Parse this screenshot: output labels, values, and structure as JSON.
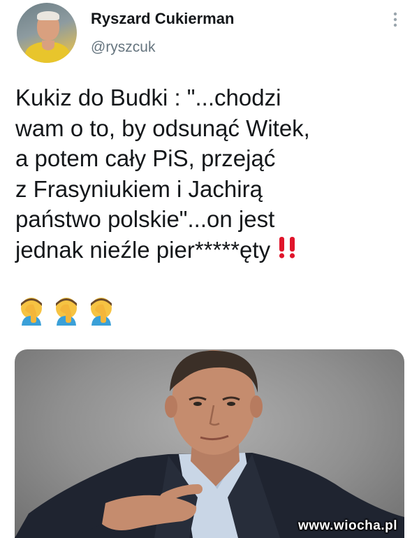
{
  "author": {
    "name": "Ryszard Cukierman",
    "handle": "@ryszcuk"
  },
  "icons": {
    "more": "more-vertical-icon",
    "emphasis": "double-exclamation-icon",
    "emoji": "person-facepalming-icon"
  },
  "tweet": {
    "lines": [
      "Kukiz do Budki : \"...chodzi",
      "wam o to, by odsunąć Witek,",
      "a potem cały PiS, przejąć",
      "z Frasyniukiem i Jachirą",
      "państwo polskie\"...on jest",
      "jednak nieźle pier*****ęty"
    ]
  },
  "media": {
    "watermark": "www.wiocha.pl"
  },
  "colors": {
    "text": "#14171a",
    "secondary": "#66757f",
    "accent_red": "#e0152b"
  }
}
